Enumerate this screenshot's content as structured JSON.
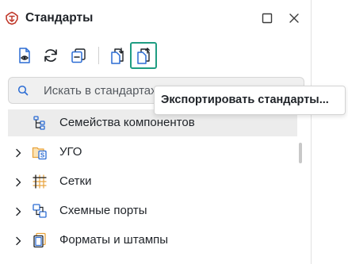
{
  "header": {
    "title": "Стандарты",
    "maximize_icon": "maximize-icon",
    "close_icon": "close-icon",
    "logo_icon": "standards-logo-icon"
  },
  "toolbar": {
    "buttons": [
      {
        "name": "view-document-button",
        "icon": "document-eye-icon"
      },
      {
        "name": "refresh-button",
        "icon": "refresh-icon"
      },
      {
        "name": "collapse-all-button",
        "icon": "collapse-icon"
      },
      {
        "name": "import-standards-button",
        "icon": "document-import-icon"
      },
      {
        "name": "export-standards-button",
        "icon": "document-export-icon",
        "active": true
      }
    ]
  },
  "search": {
    "placeholder": "Искать в стандартах"
  },
  "tree": {
    "items": [
      {
        "label": "Семейства компонентов",
        "icon": "component-families-icon",
        "expandable": false,
        "selected": true
      },
      {
        "label": "УГО",
        "icon": "folder-s-icon",
        "expandable": true
      },
      {
        "label": "Сетки",
        "icon": "grid-icon",
        "expandable": true
      },
      {
        "label": "Схемные порты",
        "icon": "schematic-ports-icon",
        "expandable": true
      },
      {
        "label": "Форматы и штампы",
        "icon": "formats-stamps-icon",
        "expandable": true
      }
    ]
  },
  "tooltip": {
    "text": "Экспортировать стандарты..."
  },
  "colors": {
    "accent": "#1f9d82",
    "icon_blue": "#2b6cd4",
    "logo_red": "#c0392b",
    "folder_orange": "#e8a33d",
    "selected_row": "#ececec"
  }
}
